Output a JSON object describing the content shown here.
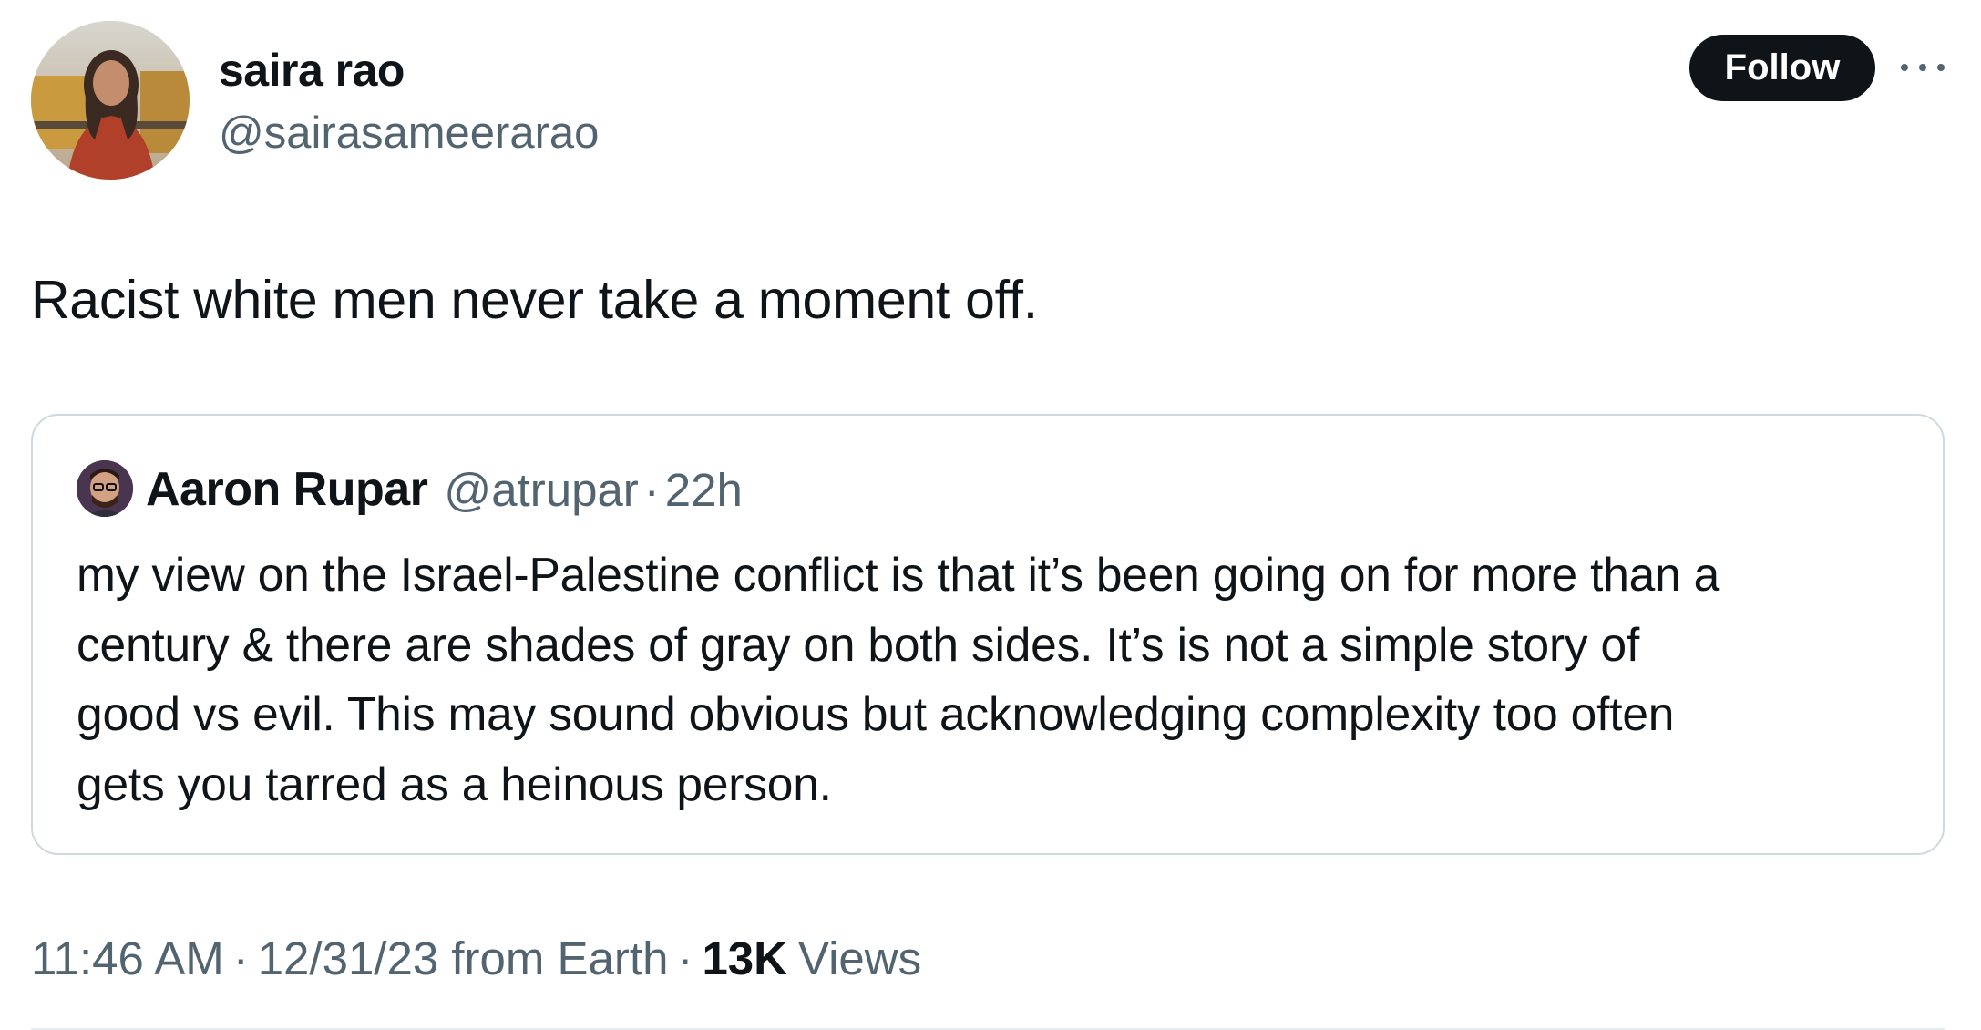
{
  "author": {
    "display_name": "saira rao",
    "handle": "@sairasameerarao"
  },
  "follow_button": {
    "label": "Follow",
    "bg_color": "#0f1419"
  },
  "more_icon": "more-horizontal-icon",
  "tweet": {
    "text": "Racist white men never take a moment off."
  },
  "quoted_tweet": {
    "display_name": "Aaron Rupar",
    "handle": "@atrupar",
    "separator": "·",
    "time": "22h",
    "text_lines": [
      "my view on the Israel-Palestine conflict is that it’s been going on for more than a",
      "century & there are shades of gray on both sides. It’s is not a simple story of",
      "good vs evil. This may sound obvious but acknowledging complexity too often",
      "gets you tarred as a heinous person."
    ]
  },
  "meta": {
    "time": "11:46 AM",
    "sep1": "·",
    "date_source": "12/31/23 from Earth",
    "sep2": "·",
    "views_count": "13K",
    "views_label": "Views"
  },
  "colors": {
    "text_primary": "#0f1419",
    "text_secondary": "#536471",
    "border": "#cfd9de"
  }
}
